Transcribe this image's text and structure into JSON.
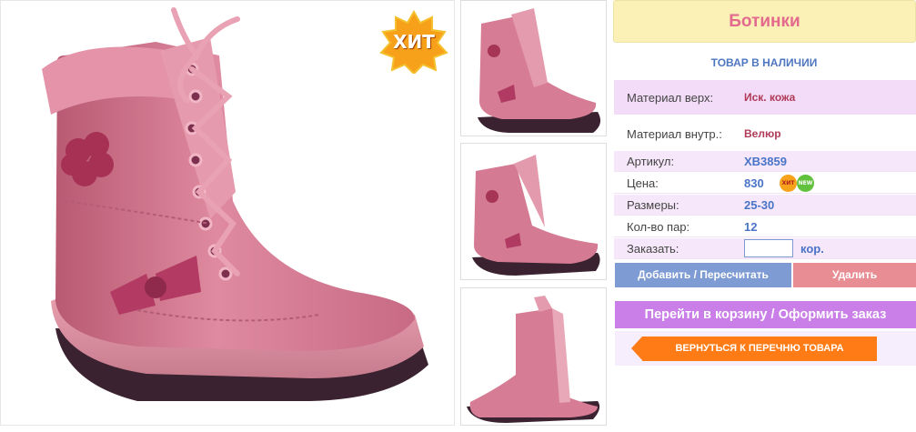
{
  "main_photo": {
    "badge": "ХИТ"
  },
  "thumbnails": [
    "boot-side-view",
    "boot-angle-view",
    "boot-inner-view"
  ],
  "product": {
    "title": "Ботинки",
    "stock_status": "ТОВАР В НАЛИЧИИ",
    "material_top_label": "Материал верх:",
    "material_top_value": "Иск. кожа",
    "material_inner_label": "Материал внутр.:",
    "material_inner_value": "Велюр",
    "article_label": "Артикул:",
    "article_value": "XB3859",
    "price_label": "Цена:",
    "price_value": "830",
    "price_badges": {
      "hit": "ХИТ",
      "new": "NEW"
    },
    "sizes_label": "Размеры:",
    "sizes_value": "25-30",
    "pairs_label": "Кол-во пар:",
    "pairs_value": "12",
    "order_label": "Заказать:",
    "order_qty": "",
    "order_unit": "кор."
  },
  "actions": {
    "add_label": "Добавить / Пересчитать",
    "delete_label": "Удалить",
    "cart_label": "Перейти в корзину / Оформить заказ",
    "back_label": "ВЕРНУТЬСЯ К ПЕРЕЧНЮ ТОВАРА"
  },
  "colors": {
    "title_bg": "#fbf0b5",
    "title_text": "#e36a8e",
    "add_button": "#7f9bd3",
    "delete_button": "#e88d94",
    "cart_button": "#c97ee8",
    "back_button": "#ff7b16",
    "boot_pink": "#d9778f"
  }
}
